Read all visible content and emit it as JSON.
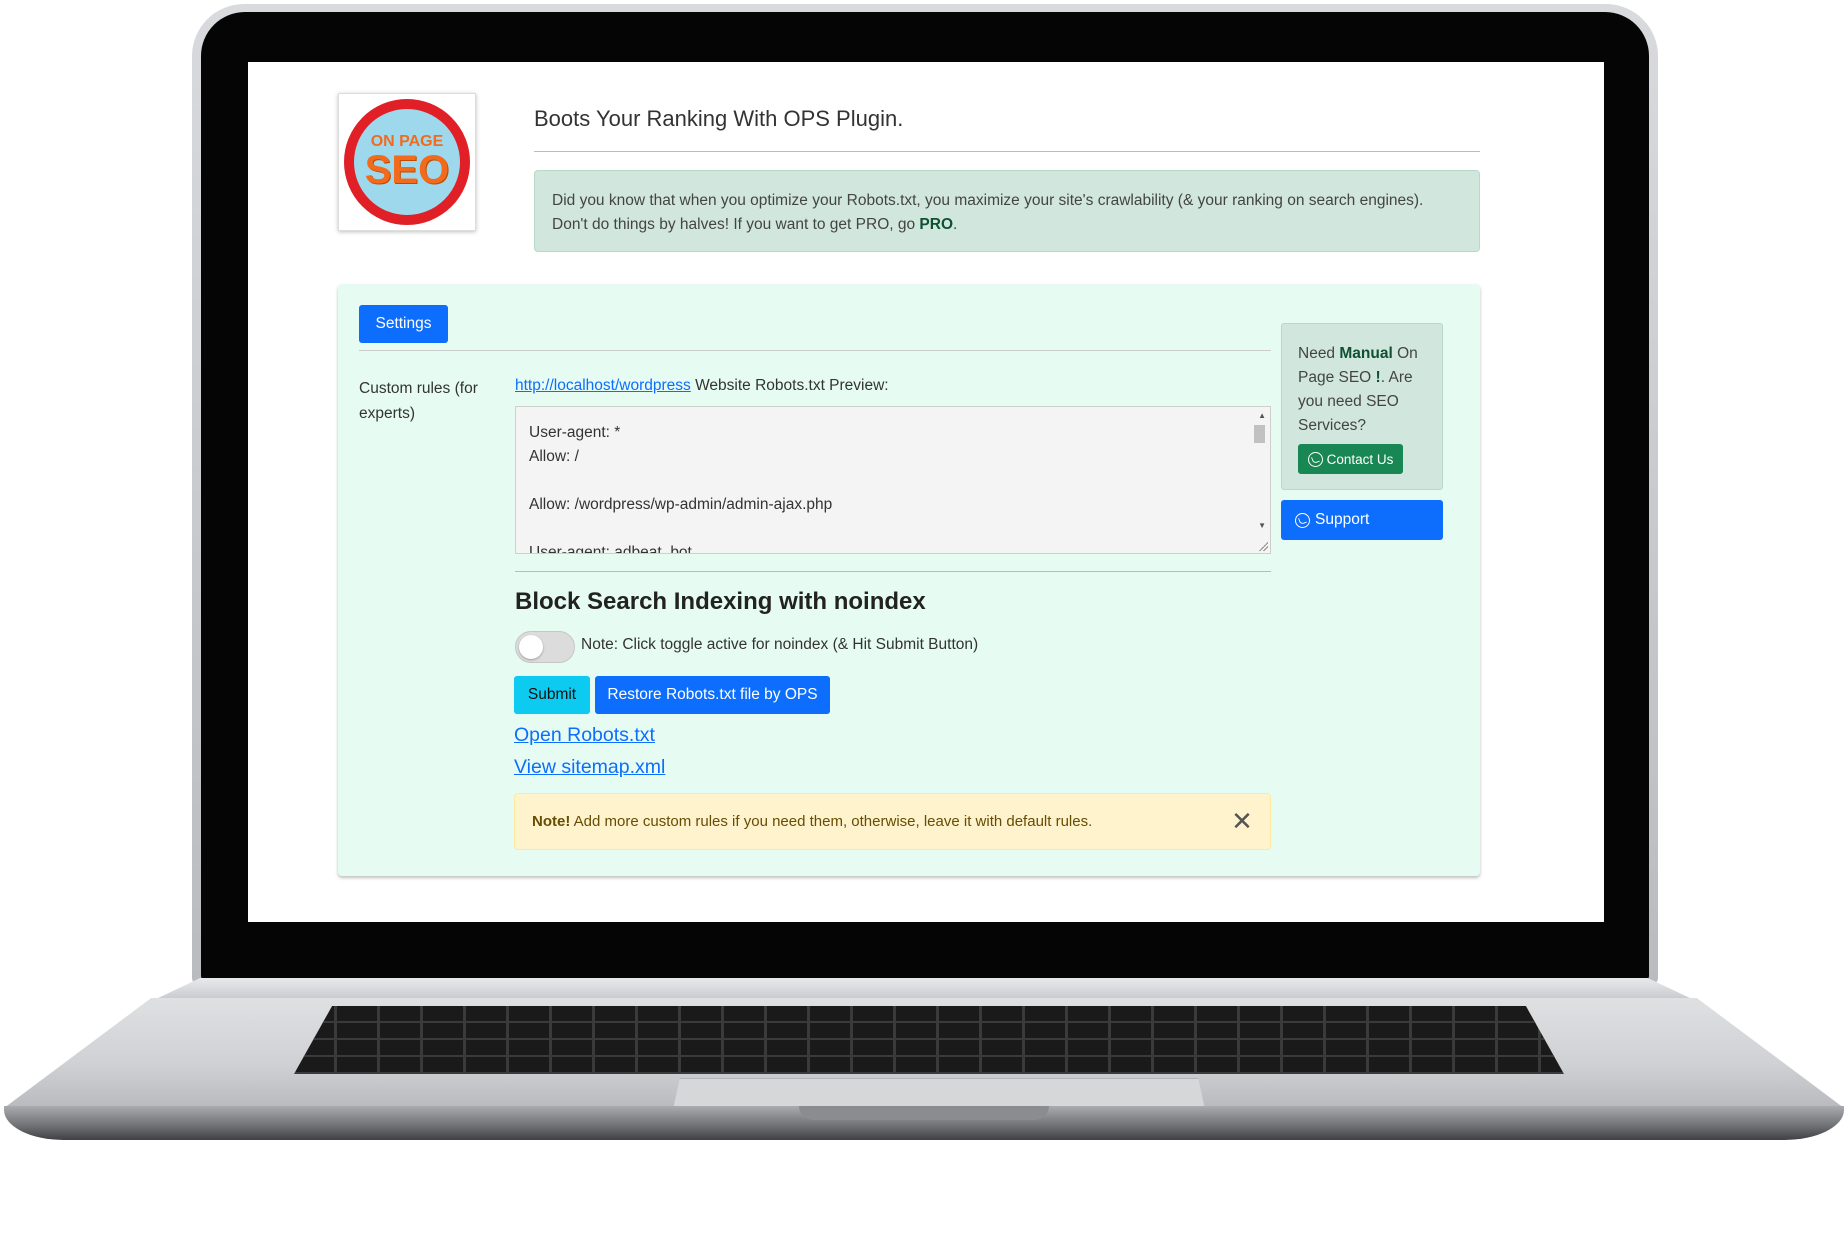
{
  "header": {
    "logo": {
      "line1": "ON PAGE",
      "line2": "SEO"
    },
    "title": "Boots Your Ranking With OPS Plugin."
  },
  "info_alert": {
    "line1": "Did you know that when you optimize your Robots.txt, you maximize your site's crawlability (& your ranking on search engines).",
    "line2_prefix": "Don't do things by halves! If you want to get PRO, go ",
    "line2_bold": "PRO",
    "line2_suffix": "."
  },
  "tabs": {
    "settings": "Settings"
  },
  "form": {
    "field_label": "Custom rules (for experts)",
    "preview_link": "http://localhost/wordpress",
    "preview_suffix": " Website Robots.txt Preview:",
    "robots_content": "User-agent: *\nAllow: /\n\nAllow: /wordpress/wp-admin/admin-ajax.php\n\nUser-agent: adbeat_bot",
    "block_heading": "Block Search Indexing with noindex",
    "toggle_note": "Note: Click toggle active for noindex (& Hit Submit Button)",
    "toggle_state": "off",
    "submit_label": "Submit",
    "restore_label": "Restore Robots.txt file by OPS",
    "open_robots_link": "Open Robots.txt",
    "view_sitemap_link": "View sitemap.xml"
  },
  "note_alert": {
    "bold": "Note!",
    "text": " Add more custom rules if you need them, otherwise, leave it with default rules.",
    "close_glyph": "✕"
  },
  "sidebar": {
    "service_prefix": "Need ",
    "service_bold": "Manual",
    "service_mid": " On Page SEO ",
    "service_bang": "!",
    "service_suffix": ". Are you need SEO Services?",
    "contact_label": "Contact Us",
    "support_label": "Support",
    "contact_icon": "whatsapp-icon",
    "support_icon": "whatsapp-icon"
  },
  "colors": {
    "primary": "#0d6efd",
    "info": "#0dcaf0",
    "success": "#198754",
    "card_bg": "#e6fcf3",
    "alert_green": "#d1e7dd",
    "alert_yellow": "#fff3cd"
  }
}
